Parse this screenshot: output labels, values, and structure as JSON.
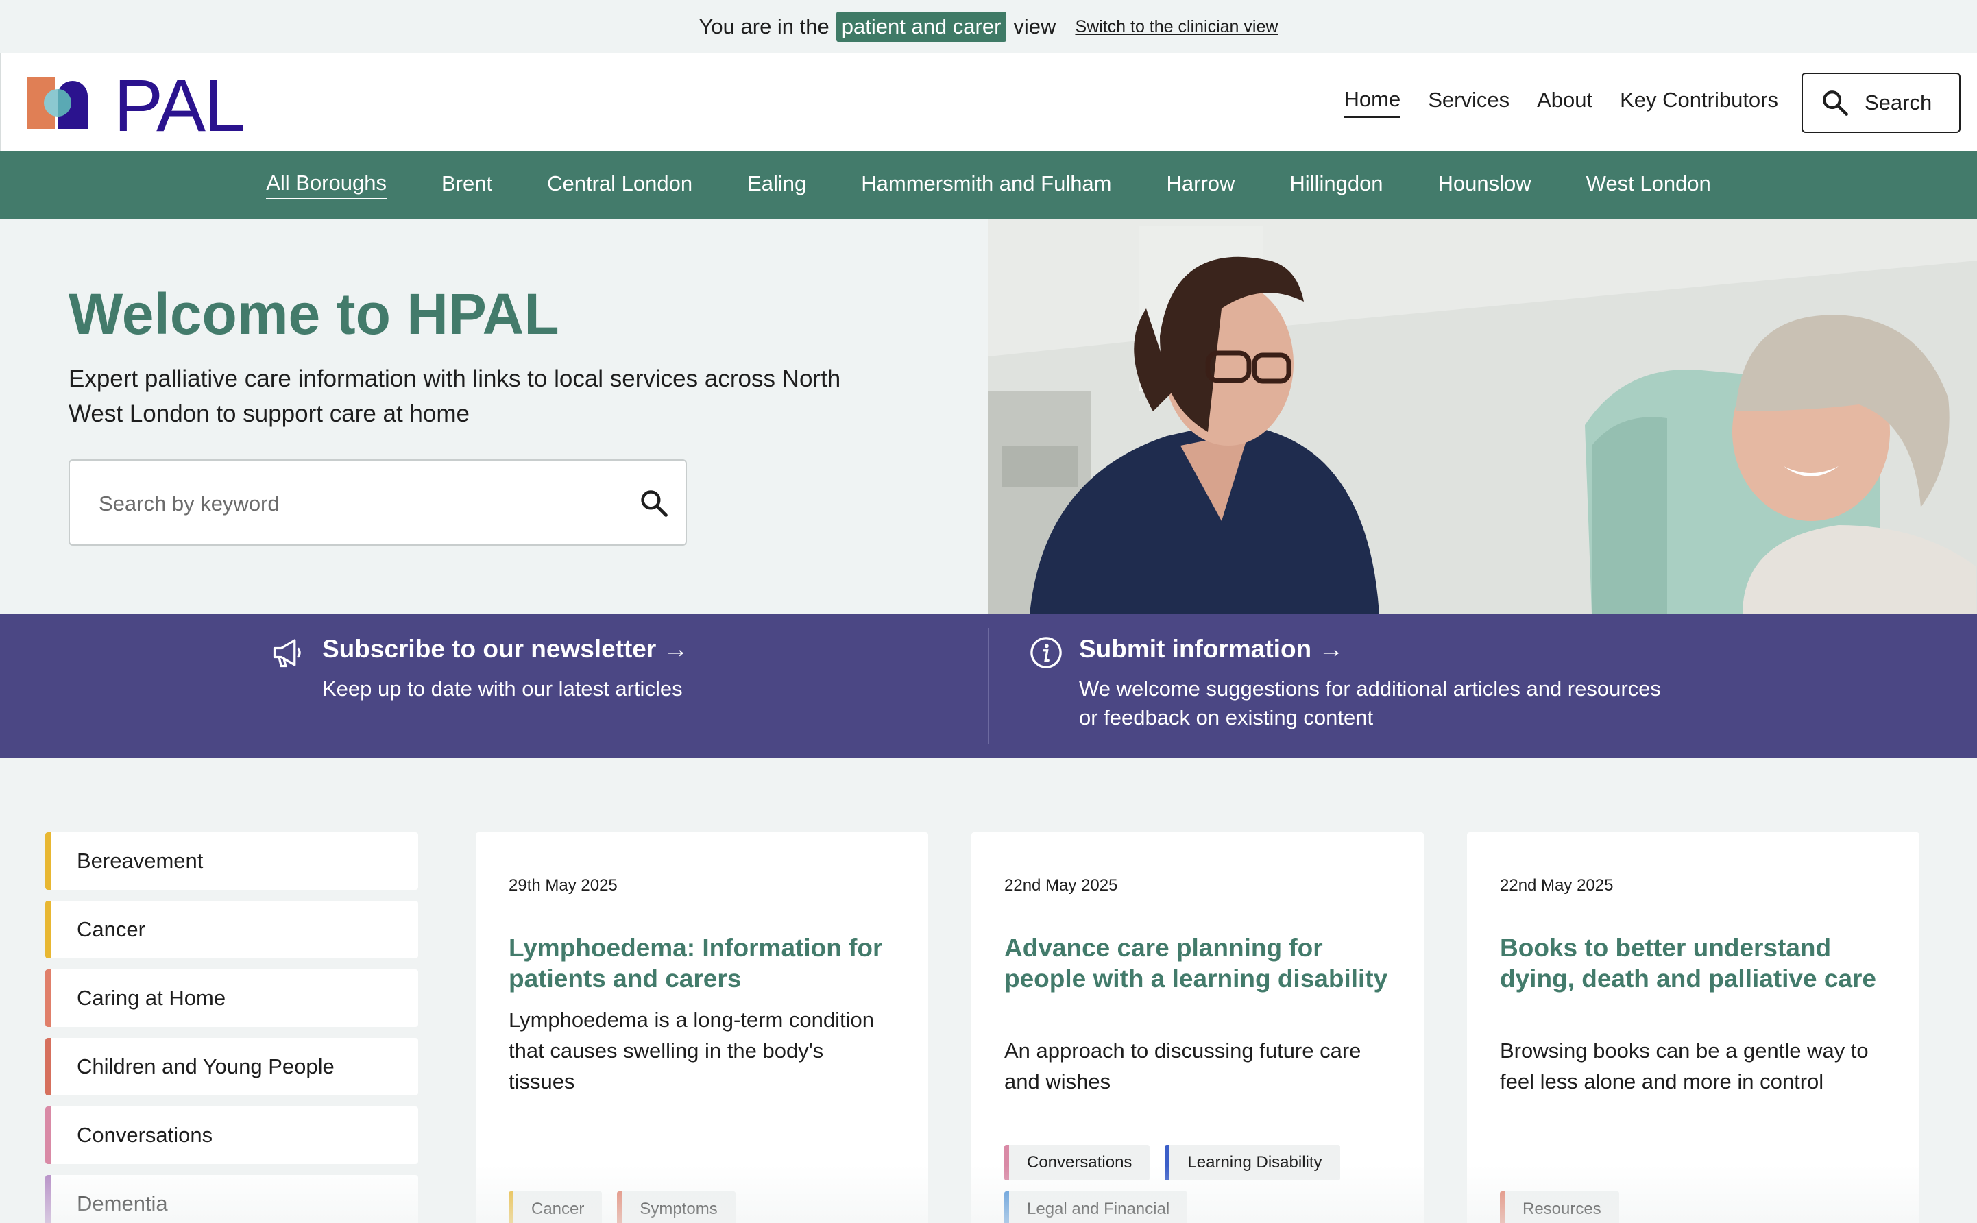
{
  "banner": {
    "prefix": "You are in the",
    "highlight": "patient and carer",
    "suffix": "view",
    "switch_link": "Switch to the clinician view"
  },
  "header": {
    "logo_text": "PAL",
    "nav": [
      {
        "label": "Home",
        "active": true
      },
      {
        "label": "Services"
      },
      {
        "label": "About"
      },
      {
        "label": "Key Contributors"
      }
    ],
    "search_label": "Search"
  },
  "boroughs": [
    {
      "label": "All Boroughs",
      "active": true
    },
    {
      "label": "Brent"
    },
    {
      "label": "Central London"
    },
    {
      "label": "Ealing"
    },
    {
      "label": "Hammersmith and Fulham"
    },
    {
      "label": "Harrow"
    },
    {
      "label": "Hillingdon"
    },
    {
      "label": "Hounslow"
    },
    {
      "label": "West London"
    }
  ],
  "hero": {
    "title": "Welcome to HPAL",
    "subtitle": "Expert palliative care information with links to local services across North West London to support care at home",
    "search_placeholder": "Search by keyword"
  },
  "cta": {
    "newsletter": {
      "title": "Subscribe to our newsletter →",
      "desc": "Keep up to date with our latest articles",
      "icon": "megaphone-icon"
    },
    "submit": {
      "title": "Submit information →",
      "desc_line1": "We welcome suggestions for additional articles and resources",
      "desc_line2": "or feedback on existing content",
      "icon": "info-icon"
    }
  },
  "categories": [
    {
      "label": "Bereavement",
      "color": "#e8b732"
    },
    {
      "label": "Cancer",
      "color": "#e8b732"
    },
    {
      "label": "Caring at Home",
      "color": "#e07f6a"
    },
    {
      "label": "Children and Young People",
      "color": "#d6705d"
    },
    {
      "label": "Conversations",
      "color": "#d98aa6"
    },
    {
      "label": "Dementia",
      "color": "#b38ac4"
    }
  ],
  "articles": [
    {
      "date": "29th May 2025",
      "title": "Lymphoedema: Information for patients and carers",
      "desc": "Lymphoedema is a long-term condition that causes swelling in the body's tissues",
      "tags": [
        {
          "label": "Cancer",
          "color": "#e8b732"
        },
        {
          "label": "Symptoms",
          "color": "#e07f6a"
        }
      ]
    },
    {
      "date": "22nd May 2025",
      "title": "Advance care planning for people with a learning disability",
      "desc": "An approach to discussing future care and wishes",
      "tags": [
        {
          "label": "Conversations",
          "color": "#d98aa6"
        },
        {
          "label": "Learning Disability",
          "color": "#3c5fc8"
        },
        {
          "label": "Legal and Financial",
          "color": "#4a8fd6"
        }
      ]
    },
    {
      "date": "22nd May 2025",
      "title": "Books to better understand dying, death and palliative care",
      "desc": "Browsing books can be a gentle way to feel less alone and more in control",
      "tags": [
        {
          "label": "Resources",
          "color": "#e07f6a"
        }
      ]
    }
  ],
  "colors": {
    "brand_green": "#437b6b",
    "brand_purple": "#4b4784",
    "logo_purple": "#2b138e"
  }
}
